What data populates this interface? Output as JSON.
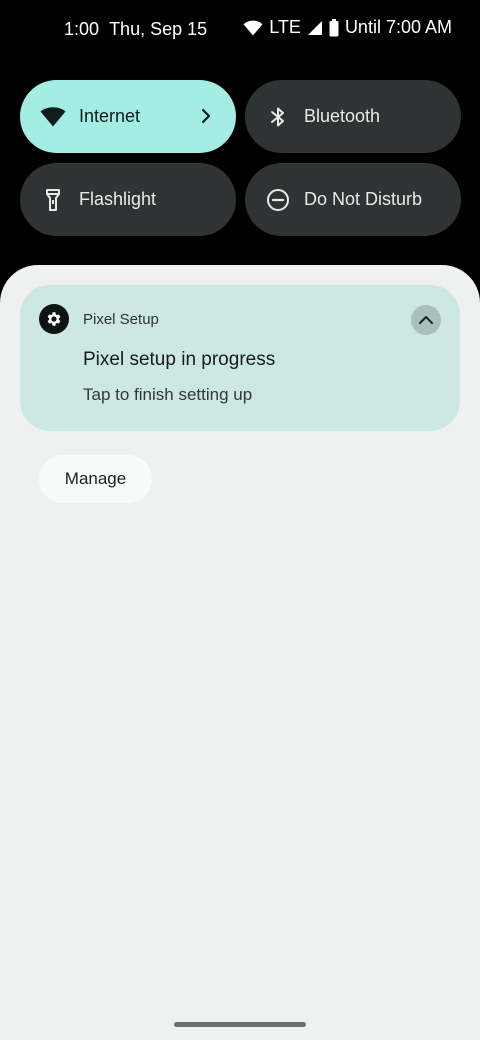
{
  "status_bar": {
    "time": "1:00",
    "date": "Thu, Sep 15",
    "network": "LTE",
    "battery_text": "Until 7:00 AM",
    "icons": [
      "wifi-icon",
      "signal-icon",
      "battery-icon"
    ]
  },
  "quick_tiles": [
    {
      "label": "Internet",
      "icon": "wifi-icon",
      "active": true
    },
    {
      "label": "Bluetooth",
      "icon": "bluetooth-icon",
      "active": false
    },
    {
      "label": "Flashlight",
      "icon": "flashlight-icon",
      "active": false
    },
    {
      "label": "Do Not Disturb",
      "icon": "do-not-disturb-icon",
      "active": false
    }
  ],
  "notification": {
    "app_name": "Pixel Setup",
    "app_icon": "gear-icon",
    "title": "Pixel setup in progress",
    "text": "Tap to finish setting up",
    "expand_icon": "chevron-up-icon"
  },
  "manage_button": {
    "label": "Manage"
  },
  "colors": {
    "background": "#000000",
    "tile_active": "#a3ede4",
    "tile_inactive": "#303333",
    "shade": "#eff1f0",
    "notification_card": "#cde7e2"
  }
}
